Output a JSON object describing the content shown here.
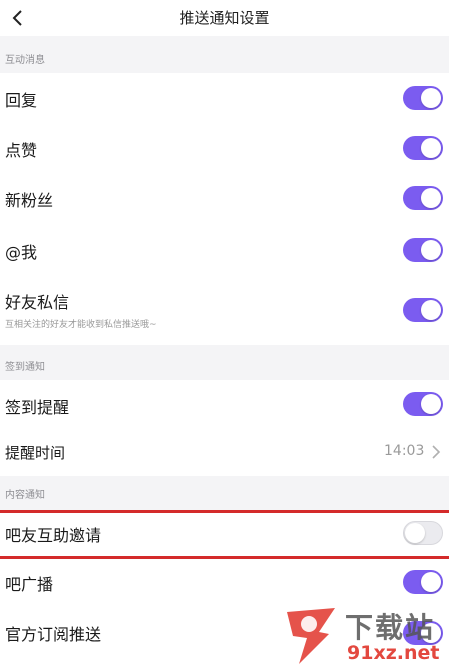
{
  "header": {
    "title": "推送通知设置",
    "back_icon": "chevron-left-icon"
  },
  "sections": {
    "interaction": "互动消息",
    "checkin": "签到通知",
    "content": "内容通知"
  },
  "items": {
    "reply": {
      "label": "回复",
      "enabled": true
    },
    "like": {
      "label": "点赞",
      "enabled": true
    },
    "new_fans": {
      "label": "新粉丝",
      "enabled": true
    },
    "mention": {
      "label": "@我",
      "enabled": true
    },
    "friend_dm": {
      "label": "好友私信",
      "desc": "互相关注的好友才能收到私信推送哦~",
      "enabled": true
    },
    "checkin_reminder": {
      "label": "签到提醒",
      "enabled": true
    },
    "reminder_time": {
      "label": "提醒时间",
      "value": "14:03"
    },
    "bar_invite": {
      "label": "吧友互助邀请",
      "enabled": false
    },
    "bar_broadcast": {
      "label": "吧广播",
      "enabled": true
    },
    "official_push": {
      "label": "官方订阅推送",
      "enabled": true
    }
  },
  "watermark": {
    "line1": "下载站",
    "line2": "91xz.net"
  },
  "colors": {
    "accent": "#7b5cf0",
    "highlight": "#d42a2a",
    "section_bg": "#f4f4f6"
  }
}
